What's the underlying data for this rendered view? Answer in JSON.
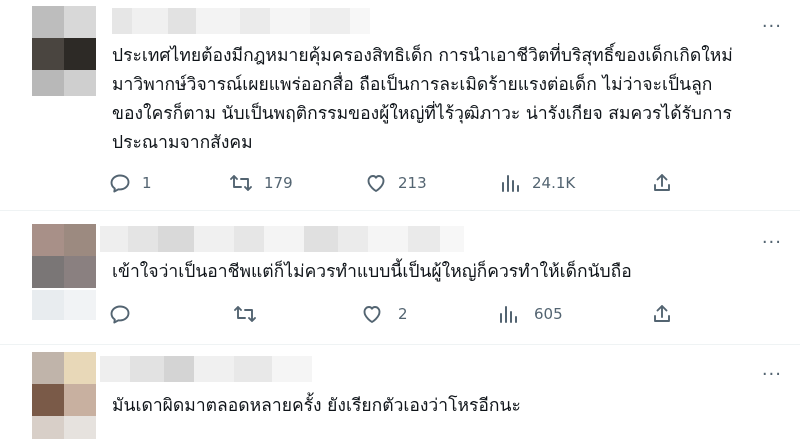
{
  "replies": [
    {
      "text": "ประเทศไทยต้องมีกฎหมายคุ้มครองสิทธิเด็ก การนำเอาชีวิตที่บริสุทธิ์ของเด็กเกิดใหม่\nมาวิพากษ์วิจารณ์เผยแพร่ออกสื่อ ถือเป็นการละเมิดร้ายแรงต่อเด็ก ไม่ว่าจะเป็นลูก\nของใครก็ตาม นับเป็นพฤติกรรมของผู้ใหญ่ที่ไร้วุฒิภาวะ น่ารังเกียจ สมควรได้รับการ\nประณามจากสังคม",
      "reply_count": "1",
      "retweet_count": "179",
      "like_count": "213",
      "view_count": "24.1K",
      "avatar_colors": [
        "#bdbdbd",
        "#d8d8d8",
        "#4a4540",
        "#2d2a26",
        "#b8b8b8",
        "#cfcfcf"
      ]
    },
    {
      "text": "เข้าใจว่าเป็นอาชีพแต่ก็ไม่ควรทำแบบนี้เป็นผู้ใหญ่ก็ควรทำให้เด็กนับถือ",
      "reply_count": "",
      "retweet_count": "",
      "like_count": "2",
      "view_count": "605",
      "avatar_colors": [
        "#a89088",
        "#9c8a80",
        "#7a7676",
        "#8a8080",
        "#e8ecef",
        "#f1f3f5"
      ]
    },
    {
      "text": "มันเดาผิดมาตลอดหลายครั้ง ยังเรียกตัวเองว่าโหรอีกนะ",
      "reply_count": "",
      "retweet_count": "",
      "like_count": "",
      "view_count": "",
      "avatar_colors": [
        "#c0b4aa",
        "#e8d8b8",
        "#7a5a48",
        "#c8b0a0"
      ]
    }
  ],
  "icons": {
    "reply": "reply-icon",
    "retweet": "retweet-icon",
    "like": "like-icon",
    "views": "views-icon",
    "share": "share-icon",
    "more": "more-icon"
  },
  "colors": {
    "text": "#0f1419",
    "muted": "#536471",
    "divider": "#eff3f4"
  },
  "more_glyph": "···"
}
